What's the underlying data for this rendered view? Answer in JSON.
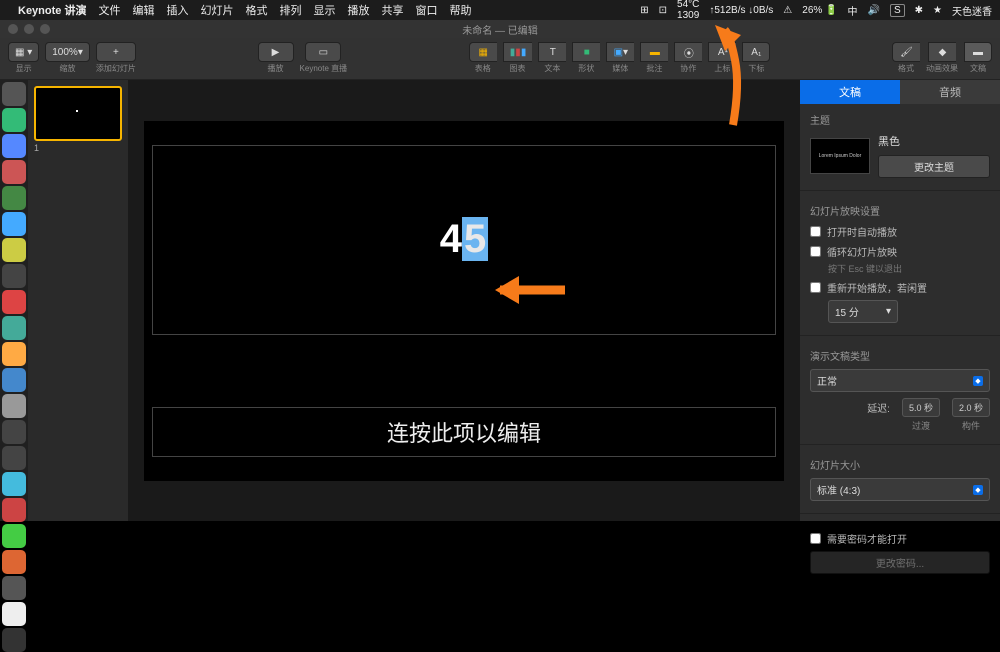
{
  "menubar": {
    "app": "Keynote 讲演",
    "items": [
      "文件",
      "编辑",
      "插入",
      "幻灯片",
      "格式",
      "排列",
      "显示",
      "播放",
      "共享",
      "窗口",
      "帮助"
    ],
    "right": {
      "temp": "54°C",
      "temp2": "1309",
      "net": "↑512B/s ↓0B/s",
      "battery": "26%",
      "lang": "中",
      "extra": "S",
      "clock": "天色迷香"
    }
  },
  "titlebar": "未命名 — 已编辑",
  "toolbar": {
    "view": "显示",
    "zoom": "100%",
    "zoom_lbl": "缩放",
    "add": "+",
    "add_lbl": "添加幻灯片",
    "play": "播放",
    "live": "Keynote 直播",
    "table": "表格",
    "chart": "图表",
    "text": "文本",
    "shape": "形状",
    "media": "媒体",
    "comment": "批注",
    "collab": "协作",
    "sup": "上标",
    "sub": "下标",
    "format": "格式",
    "anim": "动画效果",
    "doc": "文稿"
  },
  "navigator": {
    "slide": "1"
  },
  "slide": {
    "main_num": "4",
    "sup_num": "5",
    "body": "连按此项以编辑"
  },
  "inspector": {
    "tab_doc": "文稿",
    "tab_audio": "音频",
    "theme": "主题",
    "theme_name": "黑色",
    "theme_prev": "Lorem Ipsum Dolor",
    "change_theme": "更改主题",
    "slideshow_settings": "幻灯片放映设置",
    "autoplay": "打开时自动播放",
    "loop": "循环幻灯片放映",
    "loop_sub": "按下 Esc 键以退出",
    "restart": "重新开始播放，若闲置",
    "restart_val": "15 分",
    "type": "演示文稿类型",
    "type_val": "正常",
    "delay_lbl": "延迟:",
    "trans_val": "5.0 秒",
    "trans_lbl": "过渡",
    "build_val": "2.0 秒",
    "build_lbl": "构件",
    "size": "幻灯片大小",
    "size_val": "标准 (4:3)",
    "pwd": "需要密码才能打开",
    "pwd_btn": "更改密码..."
  },
  "dock_colors": [
    "#555",
    "#3b7",
    "#58f",
    "#c55",
    "#484",
    "#4af",
    "#cc4",
    "#444",
    "#d44",
    "#4a9",
    "#fa4",
    "#48c",
    "#999",
    "#444",
    "#444",
    "#4bd",
    "#c44",
    "#4c4",
    "#d63",
    "#555",
    "#eee",
    "#333"
  ]
}
